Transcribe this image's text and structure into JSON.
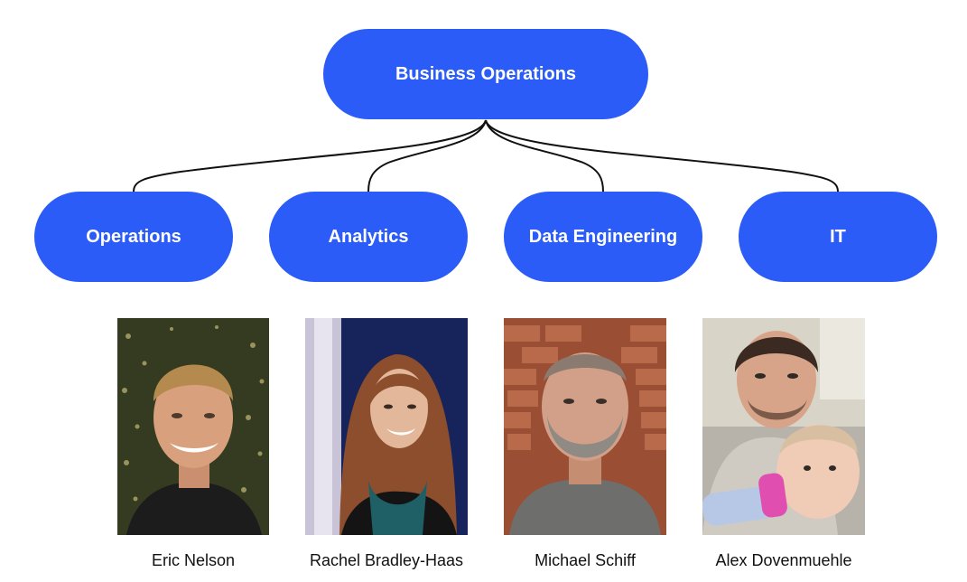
{
  "diagram": {
    "root": {
      "label": "Business Operations"
    },
    "departments": [
      {
        "label": "Operations"
      },
      {
        "label": "Analytics"
      },
      {
        "label": "Data Engineering"
      },
      {
        "label": "IT"
      }
    ],
    "people": [
      {
        "name": "Eric Nelson"
      },
      {
        "name": "Rachel Bradley-Haas"
      },
      {
        "name": "Michael Schiff"
      },
      {
        "name": "Alex Dovenmuehle"
      }
    ]
  },
  "colors": {
    "node_fill": "#2b5cf8",
    "node_text": "#ffffff",
    "connector": "#111111"
  }
}
